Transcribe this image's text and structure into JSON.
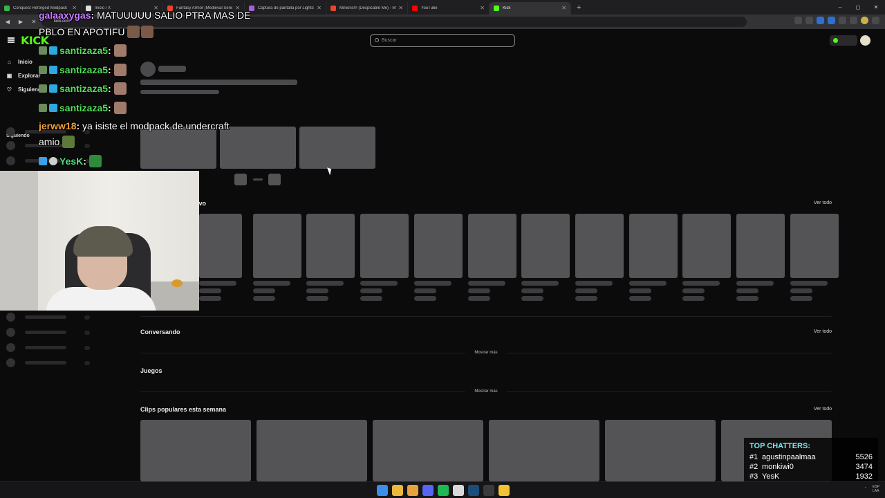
{
  "browser": {
    "tabs": [
      {
        "label": "Conquest Reforged Modpack",
        "color": "#38b54a",
        "active": false
      },
      {
        "label": "Inicio / X",
        "color": "#e0e0e0",
        "active": false
      },
      {
        "label": "Fantasy Armor (Medieval Series",
        "color": "#e8462c",
        "active": false
      },
      {
        "label": "Captura de pantalla por Lightsh",
        "color": "#a262d6",
        "active": false
      },
      {
        "label": "Minions!!! (Despicable Me) - M",
        "color": "#e8462c",
        "active": false
      },
      {
        "label": "YouTube",
        "color": "#ff0000",
        "active": false
      },
      {
        "label": "Kick",
        "color": "#53fc18",
        "active": true
      }
    ],
    "new_tab": "+",
    "url": "kick.com",
    "window_controls": [
      "–",
      "◻",
      "✕"
    ]
  },
  "kick": {
    "logo": "KICK",
    "search_placeholder": "Buscar",
    "sidebar": {
      "items": [
        {
          "label": "Inicio",
          "icon": "home-icon"
        },
        {
          "label": "Explorar",
          "icon": "compass-icon"
        },
        {
          "label": "Siguiendo",
          "icon": "heart-icon"
        }
      ],
      "following_heading": "Siguiendo"
    },
    "sections": {
      "live_suffix": "ivo",
      "conversando": "Conversando",
      "juegos": "Juegos",
      "clips": "Clips populares esta semana",
      "see_all": "Ver todo",
      "show_more": "Mostrar más"
    }
  },
  "stream_overlay": {
    "chat": [
      {
        "user": "galaaxygas",
        "user_color": "#c77bff",
        "text": "MATUUUUU SALIO PTRA MAS DE",
        "cont": "PBLO EN APOTIFU"
      },
      {
        "user": "santizaza5",
        "user_color": "#53e05a",
        "text": ""
      },
      {
        "user": "santizaza5",
        "user_color": "#53e05a",
        "text": ""
      },
      {
        "user": "santizaza5",
        "user_color": "#53e05a",
        "text": ""
      },
      {
        "user": "santizaza5",
        "user_color": "#53e05a",
        "text": ""
      },
      {
        "user": "jerww18",
        "user_color": "#f0a13a",
        "text": "ya isiste el modpack de undercraft"
      },
      {
        "user": "",
        "user_color": "#ffffff",
        "text": "amio"
      },
      {
        "user": "YesK",
        "user_color": "#4fe07a",
        "text": ""
      }
    ],
    "top_chatters": {
      "title": "TOP CHATTERS:",
      "rows": [
        {
          "rank": "#1",
          "name": "agustinpaalmaa",
          "score": "5526"
        },
        {
          "rank": "#2",
          "name": "monkiwi0",
          "score": "3474"
        },
        {
          "rank": "#3",
          "name": "YesK",
          "score": "1932"
        }
      ]
    }
  },
  "taskbar": {
    "icons": [
      {
        "name": "windows-start-icon",
        "color": "#3b8ee8"
      },
      {
        "name": "file-explorer-icon",
        "color": "#e8b93b"
      },
      {
        "name": "chrome-icon",
        "color": "#e8a23b"
      },
      {
        "name": "discord-icon",
        "color": "#5865f2"
      },
      {
        "name": "spotify-icon",
        "color": "#1db954"
      },
      {
        "name": "app-icon",
        "color": "#d9d9d9"
      },
      {
        "name": "steam-icon",
        "color": "#1b4d7a"
      },
      {
        "name": "obs-icon",
        "color": "#3a3a3a"
      },
      {
        "name": "minecraft-icon",
        "color": "#f2c232"
      }
    ],
    "language": "ESP",
    "region": "LAA"
  },
  "colors": {
    "accent": "#53fc18",
    "background": "#0b0b0c",
    "skeleton": "#545457"
  }
}
